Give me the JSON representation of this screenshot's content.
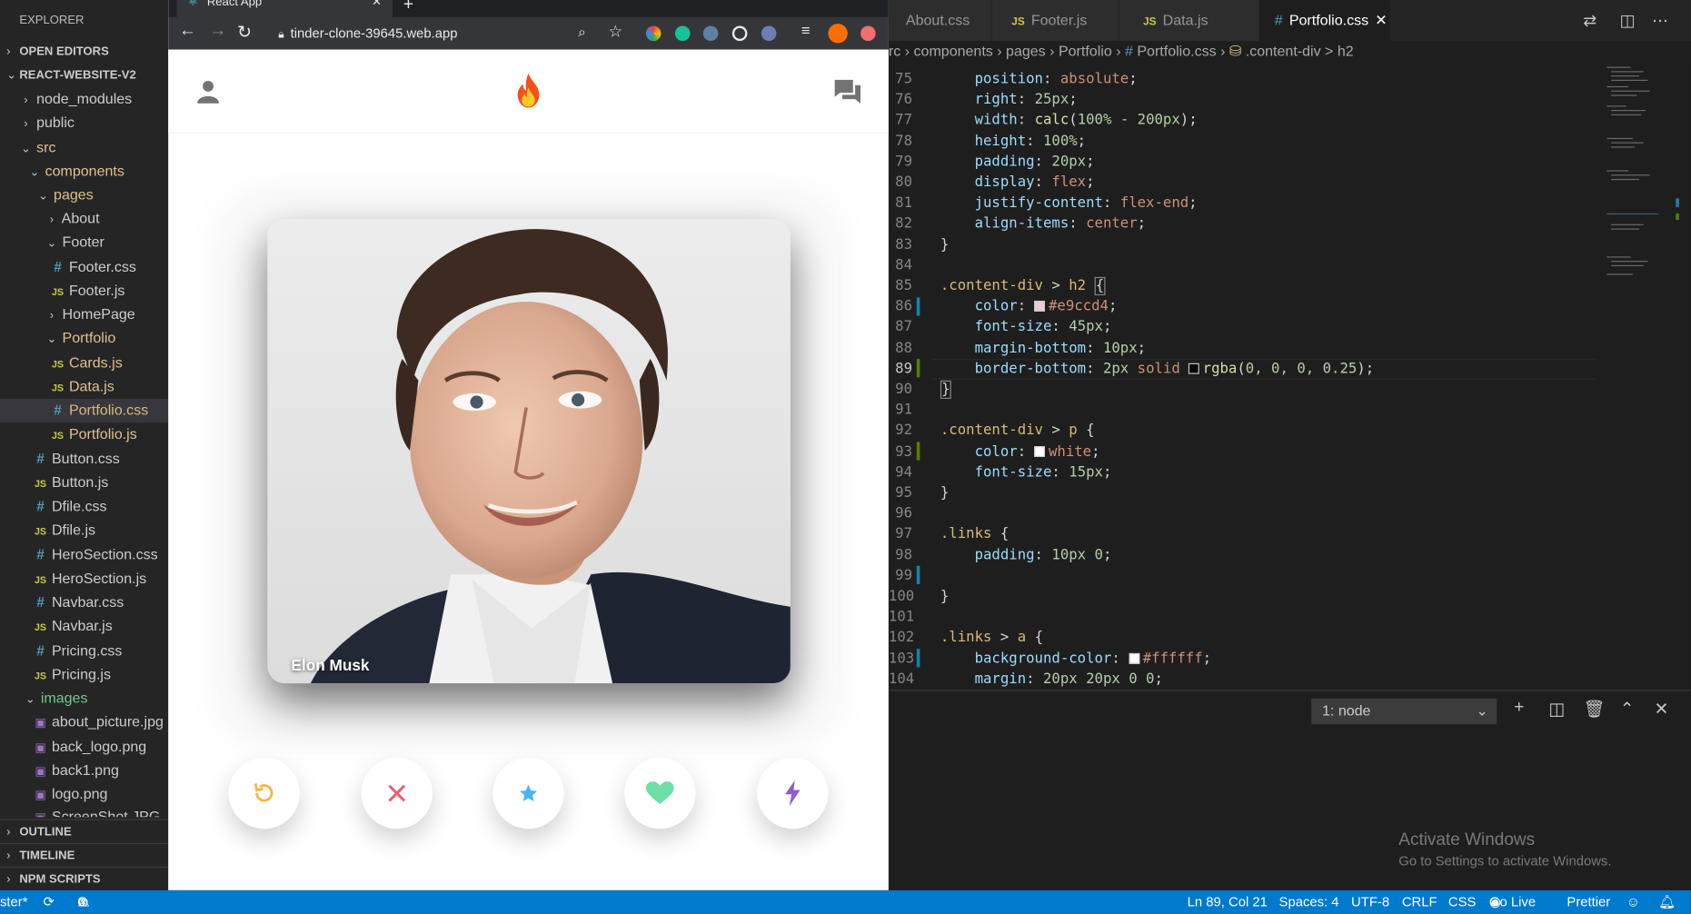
{
  "explorer": {
    "title": "EXPLORER",
    "sections": {
      "open_editors": "OPEN EDITORS",
      "project": "REACT-WEBSITE-V2",
      "outline": "OUTLINE",
      "timeline": "TIMELINE",
      "npm_scripts": "NPM SCRIPTS"
    },
    "tree": [
      {
        "label": "node_modules"
      },
      {
        "label": "public"
      },
      {
        "label": "src"
      },
      {
        "label": "components"
      },
      {
        "label": "pages"
      },
      {
        "label": "About"
      },
      {
        "label": "Footer"
      },
      {
        "label": "Footer.css"
      },
      {
        "label": "Footer.js"
      },
      {
        "label": "HomePage"
      },
      {
        "label": "Portfolio"
      },
      {
        "label": "Cards.js"
      },
      {
        "label": "Data.js"
      },
      {
        "label": "Portfolio.css"
      },
      {
        "label": "Portfolio.js"
      },
      {
        "label": "Button.css"
      },
      {
        "label": "Button.js"
      },
      {
        "label": "Dfile.css"
      },
      {
        "label": "Dfile.js"
      },
      {
        "label": "HeroSection.css"
      },
      {
        "label": "HeroSection.js"
      },
      {
        "label": "Navbar.css"
      },
      {
        "label": "Navbar.js"
      },
      {
        "label": "Pricing.css"
      },
      {
        "label": "Pricing.js"
      },
      {
        "label": "images"
      },
      {
        "label": "about_picture.jpg"
      },
      {
        "label": "back_logo.png"
      },
      {
        "label": "back1.png"
      },
      {
        "label": "logo.png"
      },
      {
        "label": "ScreenShot.JPG"
      }
    ]
  },
  "browser": {
    "tab_title": "React App",
    "url": "tinder-clone-39645.web.app",
    "card": {
      "name": "Elon Musk"
    },
    "buttons": {
      "undo": "undo-icon",
      "dislike": "close-icon",
      "superlike": "star-icon",
      "like": "heart-icon",
      "boost": "bolt-icon"
    },
    "colors": {
      "flame": "#fe3c72",
      "undo": "#f5b748",
      "dislike": "#ec5e6f",
      "star": "#4bb3f4",
      "heart": "#6ce0a6",
      "bolt": "#915dd1"
    }
  },
  "editor": {
    "tabs": [
      {
        "label": "About.css"
      },
      {
        "label": "Footer.js"
      },
      {
        "label": "Data.js"
      },
      {
        "label": "Portfolio.css"
      }
    ],
    "breadcrumb": [
      "rc",
      "components",
      "pages",
      "Portfolio",
      "Portfolio.css",
      ".content-div > h2"
    ],
    "lines": [
      {
        "n": "75"
      },
      {
        "n": "76"
      },
      {
        "n": "77"
      },
      {
        "n": "78"
      },
      {
        "n": "79"
      },
      {
        "n": "80"
      },
      {
        "n": "81"
      },
      {
        "n": "82"
      },
      {
        "n": "83"
      },
      {
        "n": "84"
      },
      {
        "n": "85"
      },
      {
        "n": "86"
      },
      {
        "n": "87"
      },
      {
        "n": "88"
      },
      {
        "n": "89"
      },
      {
        "n": "90"
      },
      {
        "n": "91"
      },
      {
        "n": "92"
      },
      {
        "n": "93"
      },
      {
        "n": "94"
      },
      {
        "n": "95"
      },
      {
        "n": "96"
      },
      {
        "n": "97"
      },
      {
        "n": "98"
      },
      {
        "n": "99"
      },
      {
        "n": "100"
      },
      {
        "n": "101"
      },
      {
        "n": "102"
      },
      {
        "n": "103"
      },
      {
        "n": "104"
      }
    ],
    "code_tokens": {
      "l75_p": "position",
      "l75_v": "absolute",
      "l76_p": "right",
      "l76_v": "25px",
      "l77_p": "width",
      "l77_f": "calc",
      "l77_v": "100% - 200px",
      "l78_p": "height",
      "l78_v": "100%",
      "l79_p": "padding",
      "l79_v": "20px",
      "l80_p": "display",
      "l80_v": "flex",
      "l81_p": "justify-content",
      "l81_v": "flex-end",
      "l82_p": "align-items",
      "l82_v": "center",
      "l85_s": ".content-div",
      "l85_t": "h2",
      "l86_p": "color",
      "l86_v": "#e9ccd4",
      "l87_p": "font-size",
      "l87_v": "45px",
      "l88_p": "margin-bottom",
      "l88_v": "10px",
      "l89_p": "border-bottom",
      "l89_v1": "2px",
      "l89_v2": "solid",
      "l89_f": "rgba",
      "l89_v3": "0, 0, 0, 0.25",
      "l92_s": ".content-div",
      "l92_t": "p",
      "l93_p": "color",
      "l93_v": "white",
      "l94_p": "font-size",
      "l94_v": "15px",
      "l97_s": ".links",
      "l98_p": "padding",
      "l98_v": "10px 0",
      "l102_s": ".links",
      "l102_t": "a",
      "l103_p": "background-color",
      "l103_v": "#ffffff",
      "l104_p": "margin",
      "l104_v": "20px 20px 0 0"
    },
    "swatches": {
      "pink": "#e9ccd4",
      "black": "#000000",
      "white": "#ffffff"
    }
  },
  "terminal": {
    "selector": "1: node",
    "watermark_title": "Activate Windows",
    "watermark_sub": "Go to Settings to activate Windows."
  },
  "status": {
    "branch": "ster*",
    "errors": "0",
    "warnings": "0",
    "position": "Ln 89, Col 21",
    "spaces": "Spaces: 4",
    "encoding": "UTF-8",
    "eol": "CRLF",
    "language": "CSS",
    "golive": "Go Live",
    "prettier": "Prettier"
  }
}
